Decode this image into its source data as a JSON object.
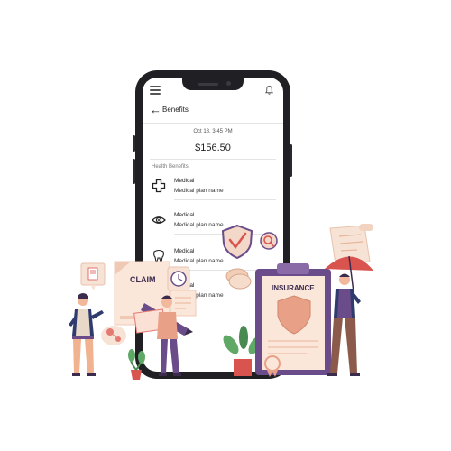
{
  "header": {
    "title": "Benefits"
  },
  "transaction": {
    "datetime": "Oct 18, 3:45 PM",
    "amount": "$156.50"
  },
  "section": {
    "label": "Health Benefits"
  },
  "benefits": [
    {
      "title": "Medical",
      "subtitle": "Medical plan name",
      "icon": "cross-icon"
    },
    {
      "title": "Medical",
      "subtitle": "Medical plan name",
      "icon": "eye-icon"
    },
    {
      "title": "Medical",
      "subtitle": "Medical plan name",
      "icon": "tooth-icon"
    },
    {
      "title": "Medical",
      "subtitle": "Medical plan name",
      "icon": "tooth-icon"
    }
  ],
  "illustration": {
    "claim_label": "CLAIM",
    "insurance_label": "INSURANCE"
  },
  "colors": {
    "accent": "#e8a086",
    "purple": "#6b4c8a",
    "green": "#4a8a52",
    "red": "#d9534f"
  }
}
